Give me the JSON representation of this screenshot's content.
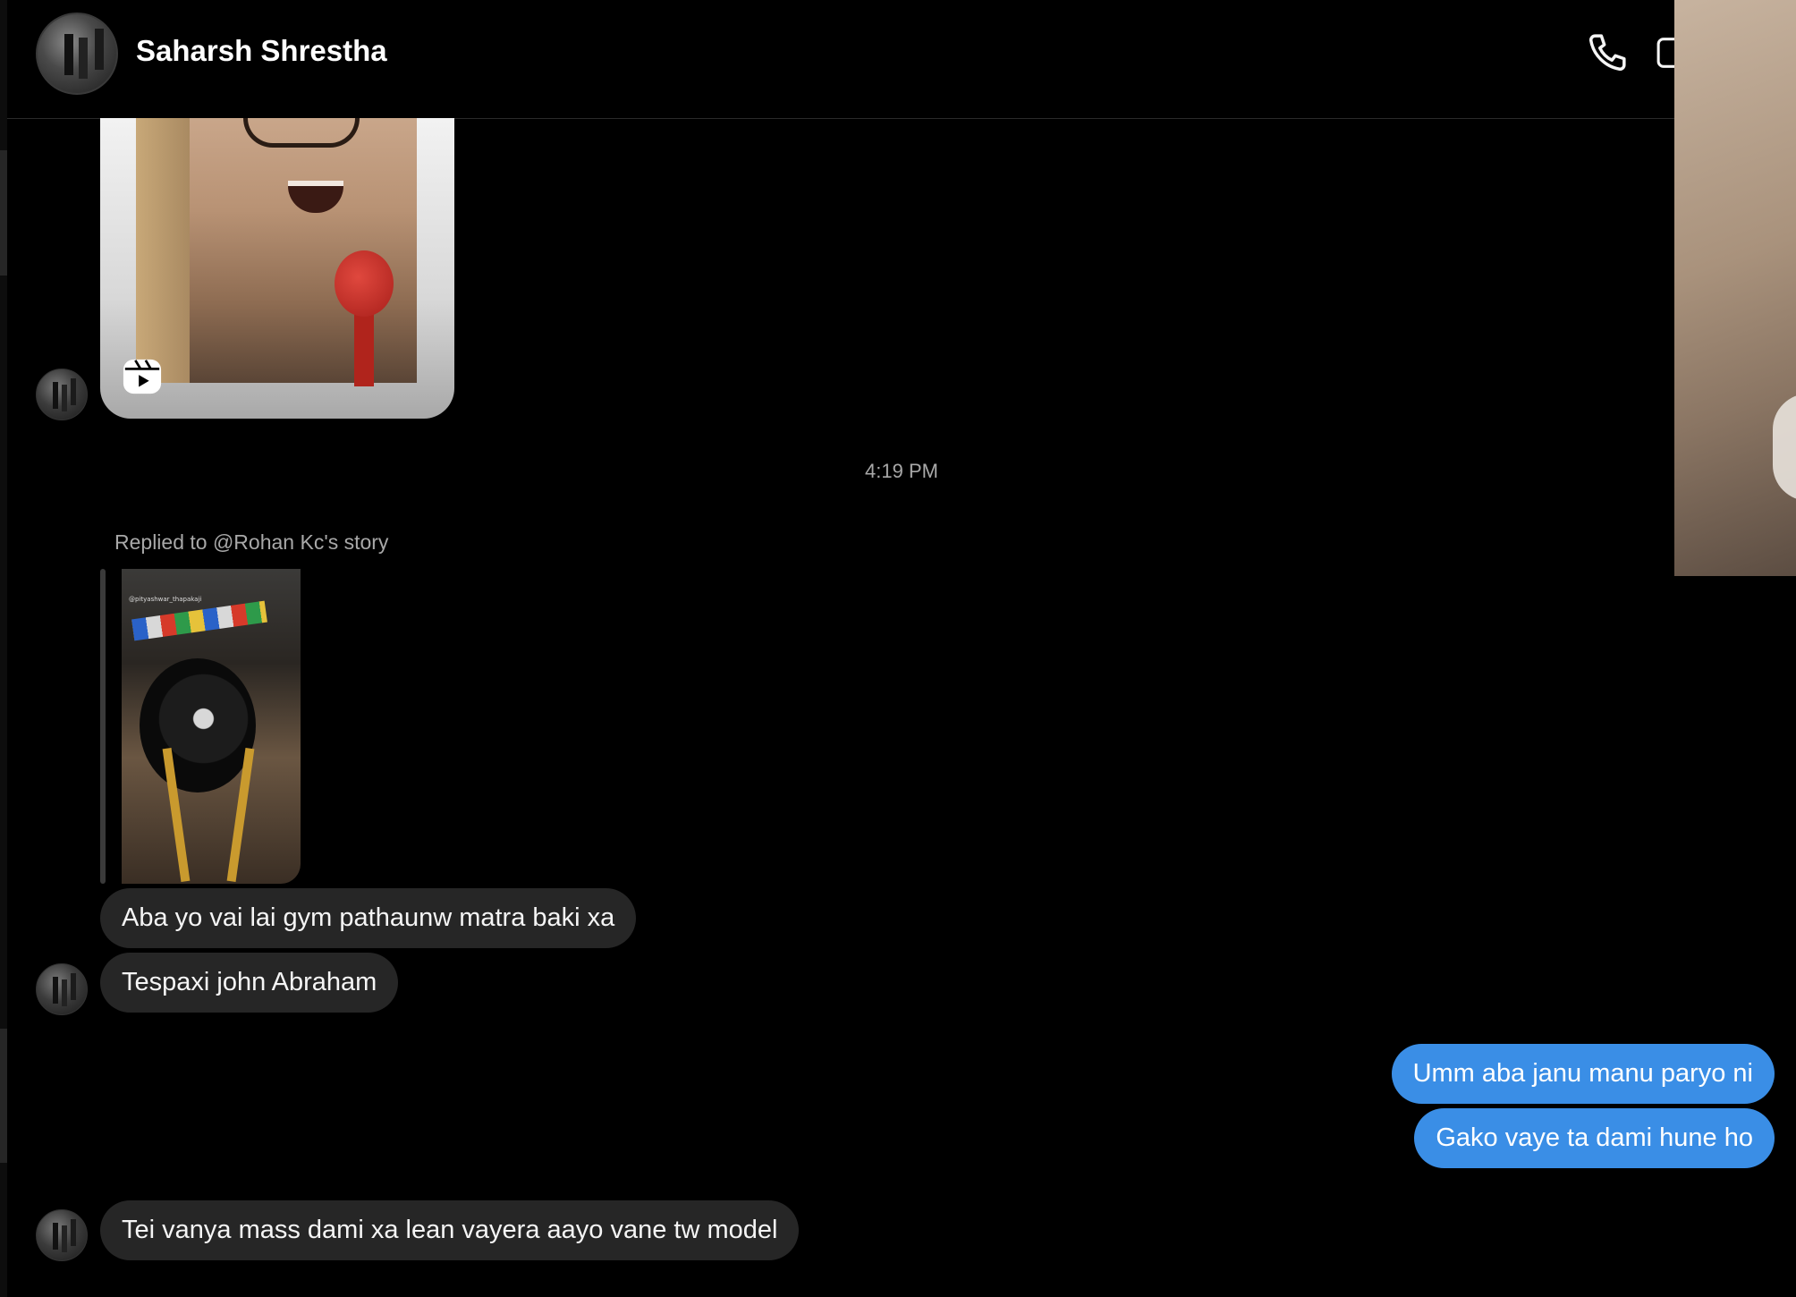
{
  "header": {
    "contact_name": "Saharsh Shrestha",
    "call_icon": "phone-icon",
    "video_icon": "video-camera-icon"
  },
  "thread": {
    "shared_reel": {
      "icon": "reels-icon"
    },
    "timestamp": "4:19 PM",
    "story_reply": {
      "label": "Replied to @Rohan Kc's story",
      "thumbnail_tag": "@pityashwar_thapakaji"
    },
    "messages": [
      {
        "from": "them",
        "text": "Aba yo vai lai gym pathaunw matra baki xa"
      },
      {
        "from": "them",
        "text": "Tespaxi john Abraham"
      },
      {
        "from": "me",
        "text": "Umm aba janu manu paryo ni"
      },
      {
        "from": "me",
        "text": "Gako vaye ta dami hune ho"
      },
      {
        "from": "them",
        "text": "Tei vanya mass dami xa lean vayera aayo vane tw model"
      }
    ]
  },
  "colors": {
    "background": "#000000",
    "incoming_bubble": "#262626",
    "outgoing_bubble": "#3a8ee6",
    "muted_text": "#a8a8a8"
  }
}
